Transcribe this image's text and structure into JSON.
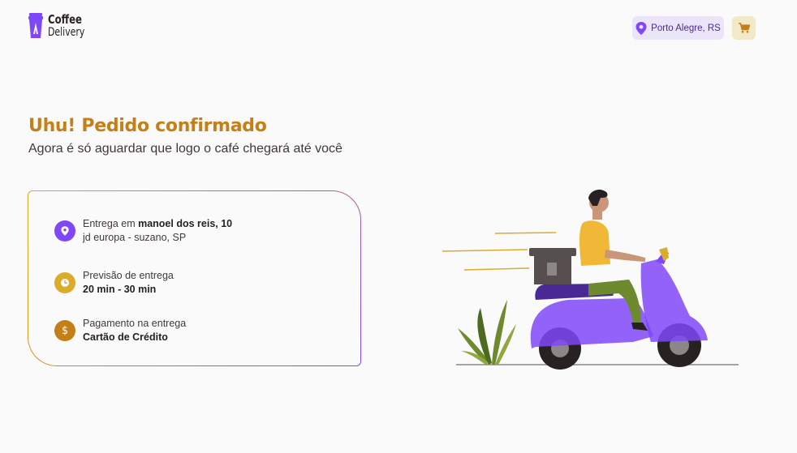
{
  "header": {
    "logo": {
      "line1": "Coffee",
      "line2": "Delivery"
    },
    "location": "Porto Alegre, RS",
    "icons": {
      "location": "map-pin-icon",
      "cart": "shopping-cart-icon"
    }
  },
  "main": {
    "title": "Uhu! Pedido confirmado",
    "subtitle": "Agora é só aguardar que logo o café chegará até você",
    "info": [
      {
        "icon": "map-pin-icon",
        "color": "#8047F8",
        "line1_prefix": "Entrega em ",
        "line1_bold": "manoel dos reis, 10",
        "line2": "jd europa - suzano, SP"
      },
      {
        "icon": "timer-icon",
        "color": "#DBAC2C",
        "line1": "Previsão de entrega",
        "line2_bold": "20 min - 30 min"
      },
      {
        "icon": "dollar-icon",
        "color": "#C47F17",
        "line1": "Pagamento na entrega",
        "line2_bold": "Cartão de Crédito"
      }
    ]
  },
  "colors": {
    "purple": "#8047F8",
    "yellow": "#DBAC2C",
    "yellow_dark": "#C47F17",
    "purple_light": "#EBE5F9",
    "yellow_light": "#F1E9C9",
    "background": "#FAFAFA"
  }
}
